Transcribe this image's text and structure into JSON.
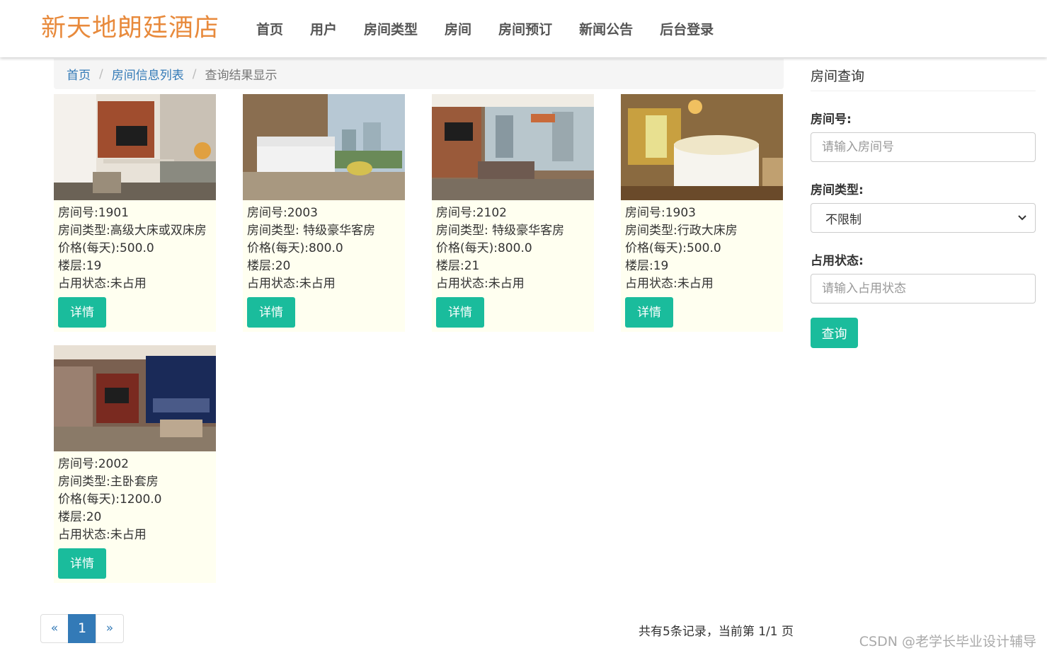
{
  "brand": "新天地朗廷酒店",
  "nav": [
    "首页",
    "用户",
    "房间类型",
    "房间",
    "房间预订",
    "新闻公告",
    "后台登录"
  ],
  "breadcrumb": {
    "home": "首页",
    "list": "房间信息列表",
    "current": "查询结果显示",
    "separator": "/"
  },
  "rooms": [
    {
      "room_no": "房间号:1901",
      "room_type": "房间类型:高级大床或双床房",
      "price": "价格(每天):500.0",
      "floor": "楼层:19",
      "status": "占用状态:未占用",
      "detail_label": "详情"
    },
    {
      "room_no": "房间号:2003",
      "room_type": "房间类型: 特级豪华客房",
      "price": "价格(每天):800.0",
      "floor": "楼层:20",
      "status": "占用状态:未占用",
      "detail_label": "详情"
    },
    {
      "room_no": "房间号:2102",
      "room_type": "房间类型: 特级豪华客房",
      "price": "价格(每天):800.0",
      "floor": "楼层:21",
      "status": "占用状态:未占用",
      "detail_label": "详情"
    },
    {
      "room_no": "房间号:1903",
      "room_type": "房间类型:行政大床房",
      "price": "价格(每天):500.0",
      "floor": "楼层:19",
      "status": "占用状态:未占用",
      "detail_label": "详情"
    },
    {
      "room_no": "房间号:2002",
      "room_type": "房间类型:主卧套房",
      "price": "价格(每天):1200.0",
      "floor": "楼层:20",
      "status": "占用状态:未占用",
      "detail_label": "详情"
    }
  ],
  "search": {
    "title": "房间查询",
    "room_no_label": "房间号:",
    "room_no_placeholder": "请输入房间号",
    "room_type_label": "房间类型:",
    "room_type_selected": "不限制",
    "status_label": "占用状态:",
    "status_placeholder": "请输入占用状态",
    "submit_label": "查询"
  },
  "pagination": {
    "prev": "«",
    "current": "1",
    "next": "»",
    "info": "共有5条记录，当前第 1/1 页"
  },
  "watermark": "CSDN @老学长毕业设计辅导",
  "colors": {
    "brand": "#e88a3c",
    "accent": "#1abc9c",
    "link": "#337ab7",
    "card_bg": "#fffff0"
  }
}
